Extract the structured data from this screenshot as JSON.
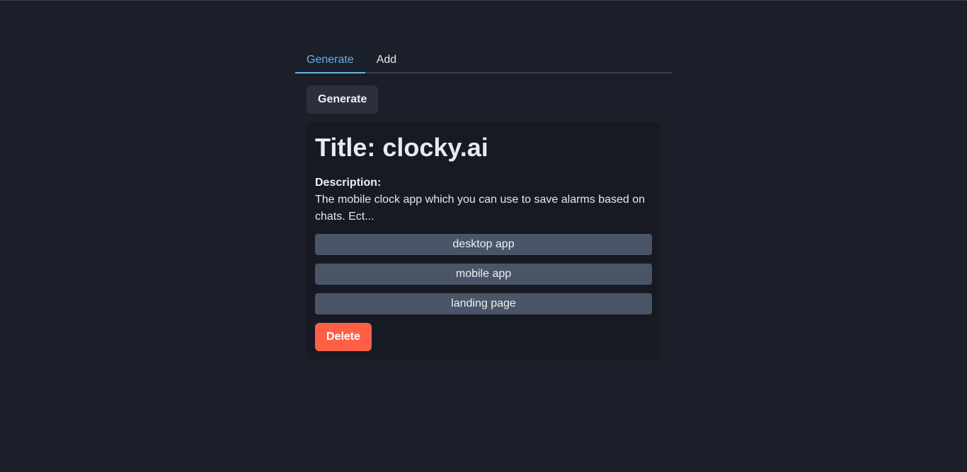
{
  "tabs": [
    {
      "label": "Generate",
      "active": true
    },
    {
      "label": "Add",
      "active": false
    }
  ],
  "generate_button": {
    "label": "Generate"
  },
  "card": {
    "title": "Title: clocky.ai",
    "description_label": "Description:",
    "description": "The mobile clock app which you can use to save alarms based on chats. Ect...",
    "tags": [
      "desktop app",
      "mobile app",
      "landing page"
    ],
    "delete_label": "Delete"
  },
  "colors": {
    "background": "#1b1f2a",
    "active_tab": "#63b3ed",
    "card_background": "#171a22",
    "tag_background": "#4a5568",
    "delete_background": "#ff5f45"
  }
}
